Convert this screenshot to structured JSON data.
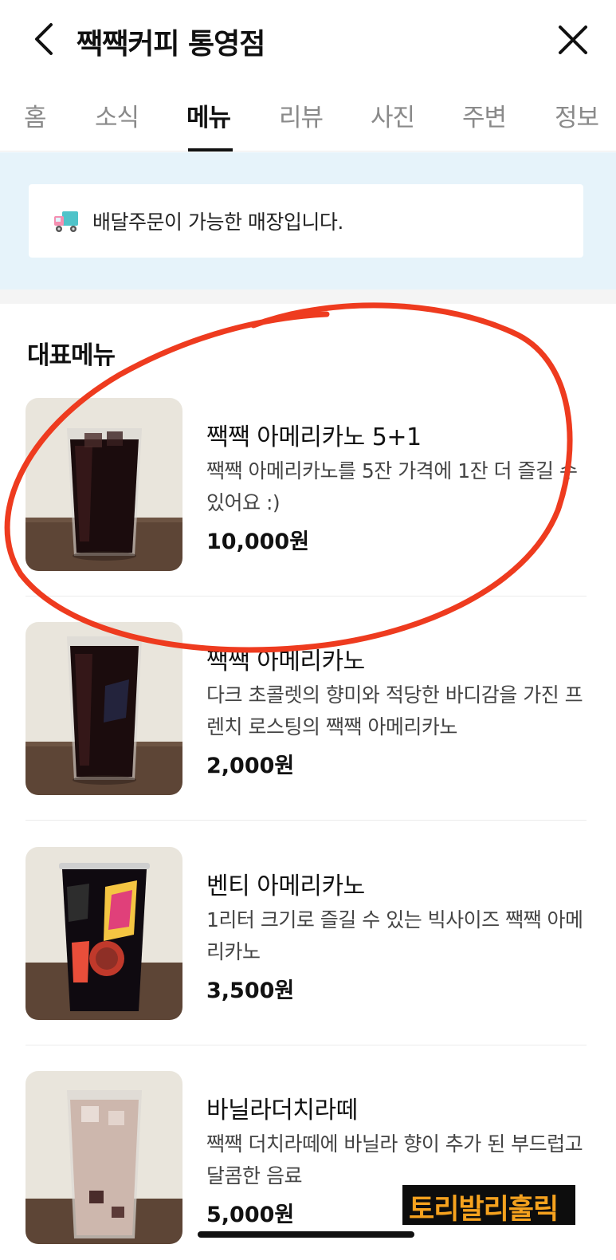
{
  "header": {
    "title": "짹짹커피 통영점",
    "back_icon": "chevron-left-icon",
    "close_icon": "close-icon"
  },
  "tabs": [
    {
      "label": "홈",
      "active": false
    },
    {
      "label": "소식",
      "active": false
    },
    {
      "label": "메뉴",
      "active": true
    },
    {
      "label": "리뷰",
      "active": false
    },
    {
      "label": "사진",
      "active": false
    },
    {
      "label": "주변",
      "active": false
    },
    {
      "label": "정보",
      "active": false
    }
  ],
  "banner": {
    "icon": "delivery-truck-icon",
    "text": "배달주문이 가능한 매장입니다."
  },
  "section_title": "대표메뉴",
  "menu_items": [
    {
      "name": "짹짹 아메리카노 5+1",
      "desc": "짹짹 아메리카노를 5잔 가격에 1잔 더 즐길 수 있어요 :)",
      "price": "10,000원",
      "image": "iced-americano-glass"
    },
    {
      "name": "짹짹 아메리카노",
      "desc": "다크 초콜렛의 향미와 적당한 바디감을 가진 프렌치 로스팅의 짹짹 아메리카노",
      "price": "2,000원",
      "image": "iced-americano-glass"
    },
    {
      "name": "벤티 아메리카노",
      "desc": "1리터 크기로 즐길 수 있는 빅사이즈 짹짹 아메리카노",
      "price": "3,500원",
      "image": "venti-americano-cup"
    },
    {
      "name": "바닐라더치라떼",
      "desc": "짹짹 더치라떼에 바닐라 향이 추가 된 부드럽고 달콤한 음료",
      "price": "5,000원",
      "image": "vanilla-latte-glass"
    }
  ],
  "watermark": "토리발리훌릭",
  "colors": {
    "banner_bg": "#e6f3fa",
    "annotation_red": "#ee3b1f",
    "watermark_text": "#f6a21e"
  }
}
